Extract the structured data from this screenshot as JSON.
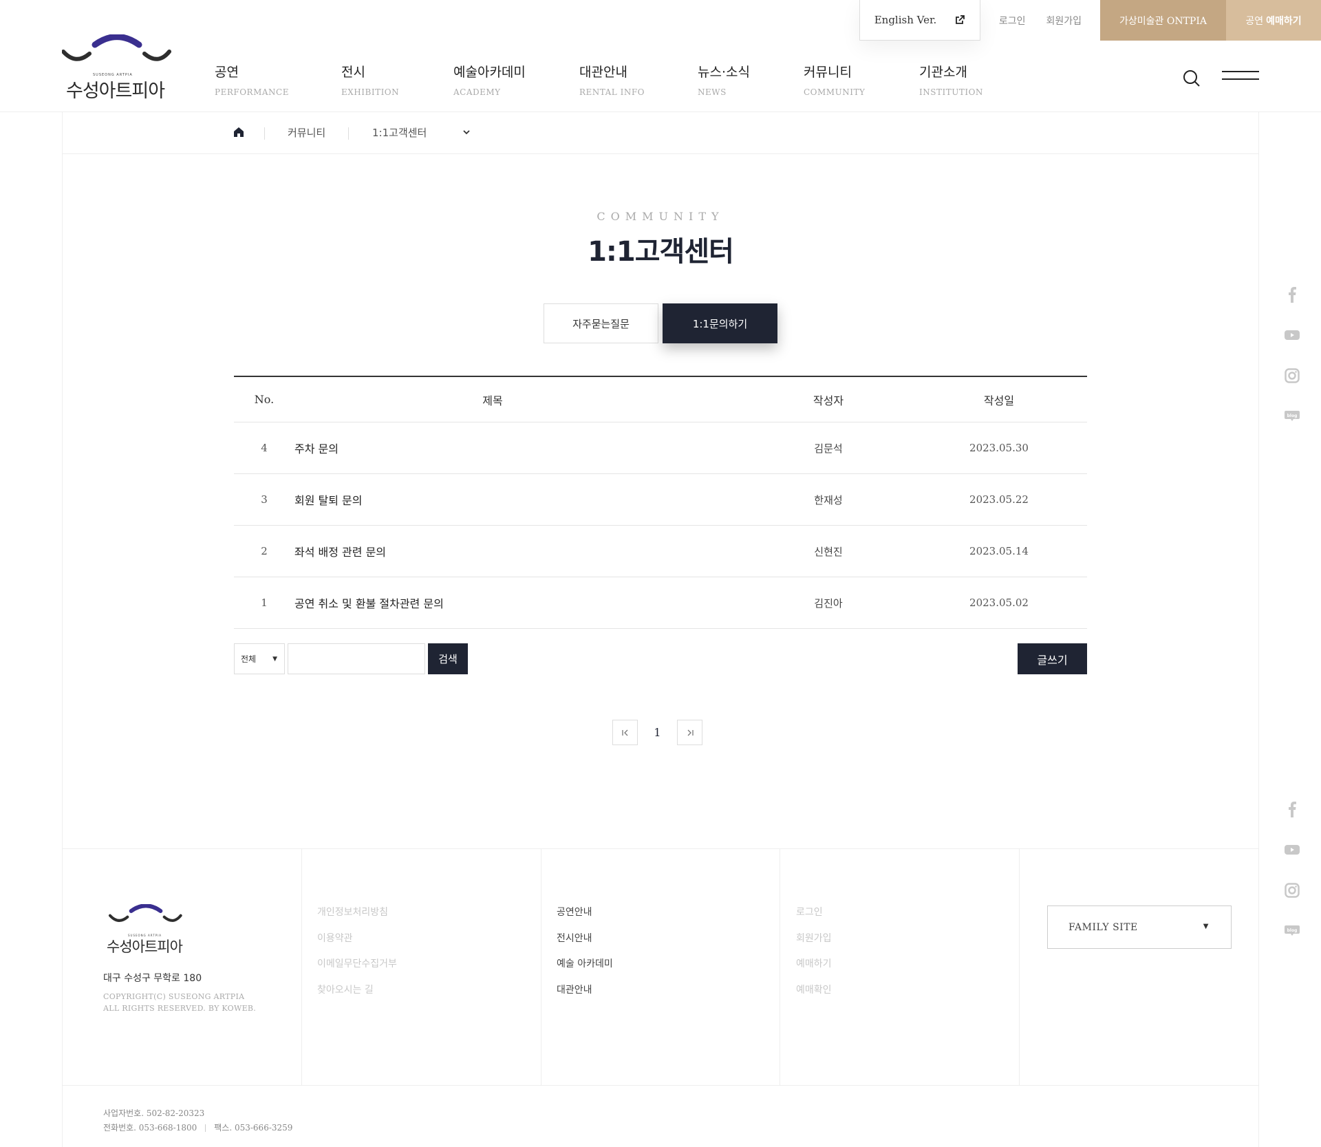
{
  "colors": {
    "navy": "#1f2433",
    "gold": "#c4a783",
    "gold_light": "#d7bd9c",
    "logo_purple": "#3a2f8f"
  },
  "util": {
    "english": "English Ver.",
    "login": "로그인",
    "join": "회원가입",
    "ontpia": "가상미술관 ONTPIA",
    "ticket_prefix": "공연",
    "ticket_bold": "예매하기"
  },
  "logo": {
    "kname": "수성아트피아",
    "ename": "SUSEONG ARTPIA"
  },
  "gnb": [
    {
      "ko": "공연",
      "en": "PERFORMANCE"
    },
    {
      "ko": "전시",
      "en": "EXHIBITION"
    },
    {
      "ko": "예술아카데미",
      "en": "ACADEMY"
    },
    {
      "ko": "대관안내",
      "en": "RENTAL INFO"
    },
    {
      "ko": "뉴스·소식",
      "en": "NEWS"
    },
    {
      "ko": "커뮤니티",
      "en": "COMMUNITY"
    },
    {
      "ko": "기관소개",
      "en": "INSTITUTION"
    }
  ],
  "breadcrumb": {
    "depth1": "커뮤니티",
    "depth2": "1:1고객센터"
  },
  "page": {
    "eyebrow": "COMMUNITY",
    "title": "1:1고객센터"
  },
  "tabs": [
    {
      "label": "자주묻는질문",
      "active": false
    },
    {
      "label": "1:1문의하기",
      "active": true
    }
  ],
  "table": {
    "headers": {
      "no": "No.",
      "title": "제목",
      "writer": "작성자",
      "date": "작성일"
    },
    "rows": [
      {
        "no": "4",
        "title": "주차 문의",
        "writer": "김문석",
        "date": "2023.05.30"
      },
      {
        "no": "3",
        "title": "회원 탈퇴 문의",
        "writer": "한재성",
        "date": "2023.05.22"
      },
      {
        "no": "2",
        "title": "좌석 배정 관련 문의",
        "writer": "신현진",
        "date": "2023.05.14"
      },
      {
        "no": "1",
        "title": "공연 취소 및 환불 절차관련 문의",
        "writer": "김진아",
        "date": "2023.05.02"
      }
    ]
  },
  "search": {
    "select_value": "전체",
    "input_value": "",
    "button": "검색"
  },
  "write_button": "글쓰기",
  "pagination": {
    "current": "1"
  },
  "sns": [
    "facebook-icon",
    "youtube-icon",
    "instagram-icon",
    "blog-icon"
  ],
  "footer": {
    "address": "대구 수성구 무학로 180",
    "copyright1": "COPYRIGHT(C) SUSEONG ARTPIA",
    "copyright2": "ALL RIGHTS RESERVED. BY KOWEB.",
    "col1": [
      "개인정보처리방침",
      "이용약관",
      "이메일무단수집거부",
      "찾아오시는 길"
    ],
    "col2": [
      "공연안내",
      "전시안내",
      "예술 아카데미",
      "대관안내"
    ],
    "col3": [
      "로그인",
      "회원가입",
      "예매하기",
      "예매확인"
    ],
    "family_site": "FAMILY SITE",
    "biz_no": "사업자번호. 502-82-20323",
    "tel": "전화번호. 053-668-1800",
    "fax": "팩스. 053-666-3259"
  }
}
